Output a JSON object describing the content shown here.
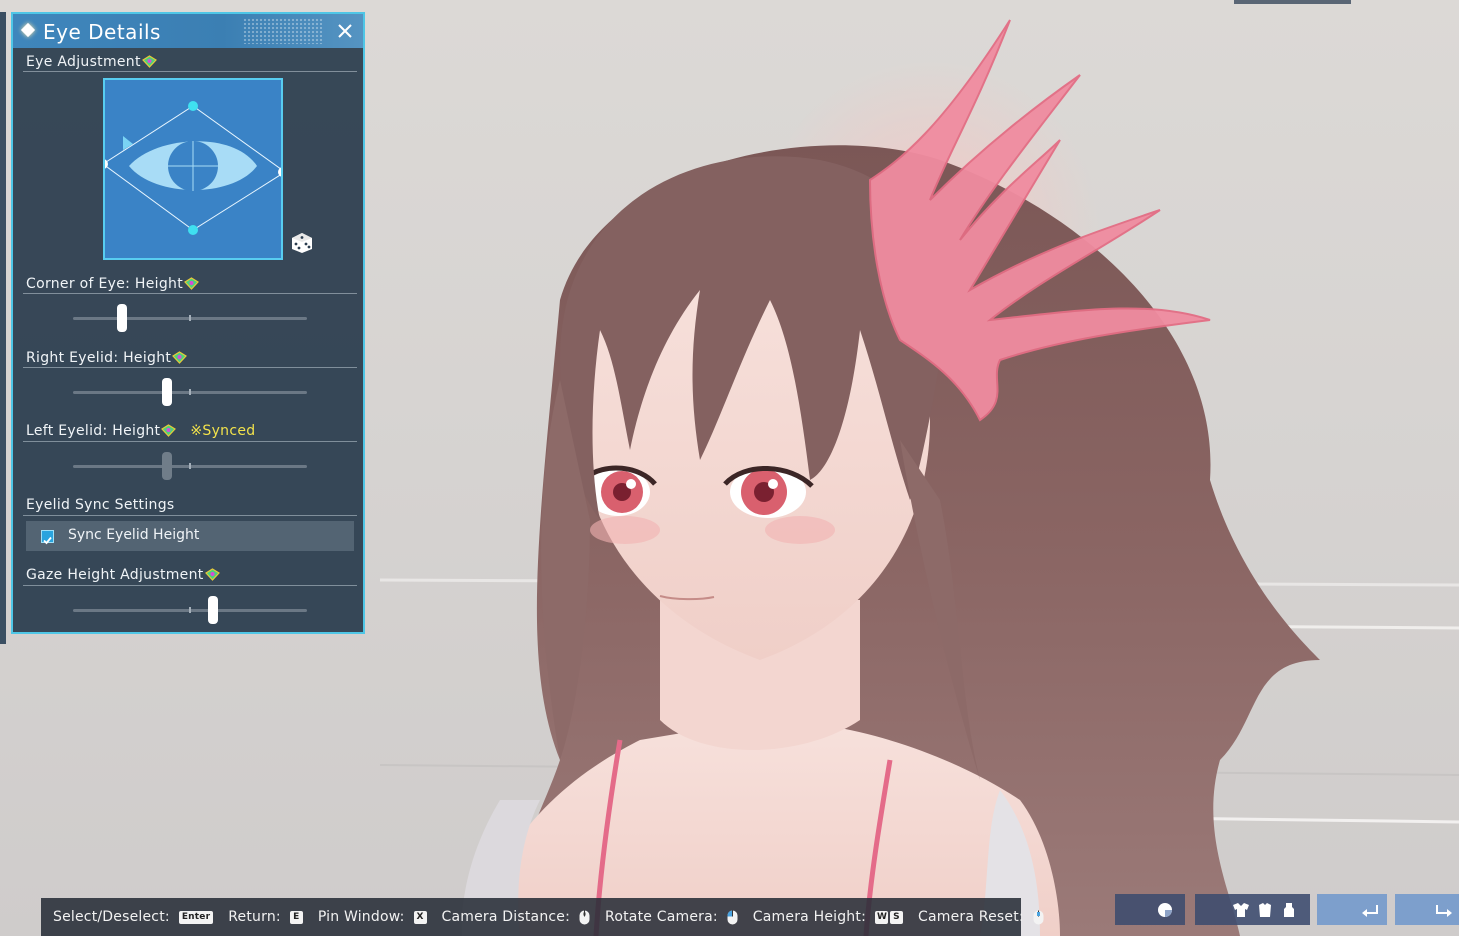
{
  "panel": {
    "title": "Eye Details",
    "sections": {
      "eye_adjustment": "Eye Adjustment",
      "corner_of_eye": "Corner of Eye: Height",
      "right_eyelid": "Right Eyelid: Height",
      "left_eyelid": "Left Eyelid: Height",
      "left_eyelid_status": "※Synced",
      "eyelid_sync": "Eyelid Sync Settings",
      "gaze_height": "Gaze Height Adjustment"
    },
    "sync_checkbox_label": "Sync Eyelid Height",
    "sync_checked": true,
    "slider_values": {
      "corner_of_eye": 0.21,
      "right_eyelid": 0.4,
      "left_eyelid": 0.4,
      "gaze_height": 0.6
    }
  },
  "hints": {
    "select": "Select/Deselect:",
    "select_key": "Enter",
    "return": "Return:",
    "return_key": "E",
    "pin": "Pin Window:",
    "pin_key": "X",
    "cam_distance": "Camera Distance:",
    "rotate": "Rotate Camera:",
    "height": "Camera Height:",
    "height_key1": "W",
    "height_key2": "S",
    "reset": "Camera Reset:"
  },
  "colors": {
    "accent": "#4fc6e6",
    "synced": "#f2e24b",
    "panel_bg": "#2a3c4e"
  },
  "icons": {
    "title": "diamond-icon",
    "close": "close-icon",
    "random": "dice-icon",
    "gem": "gem-icon",
    "checkbox": "checkbox-icon",
    "mouse": "mouse-icon",
    "sticker": "sticker-icon",
    "outfit": "outfit-icon",
    "undo": "undo-icon",
    "redo": "redo-icon"
  }
}
